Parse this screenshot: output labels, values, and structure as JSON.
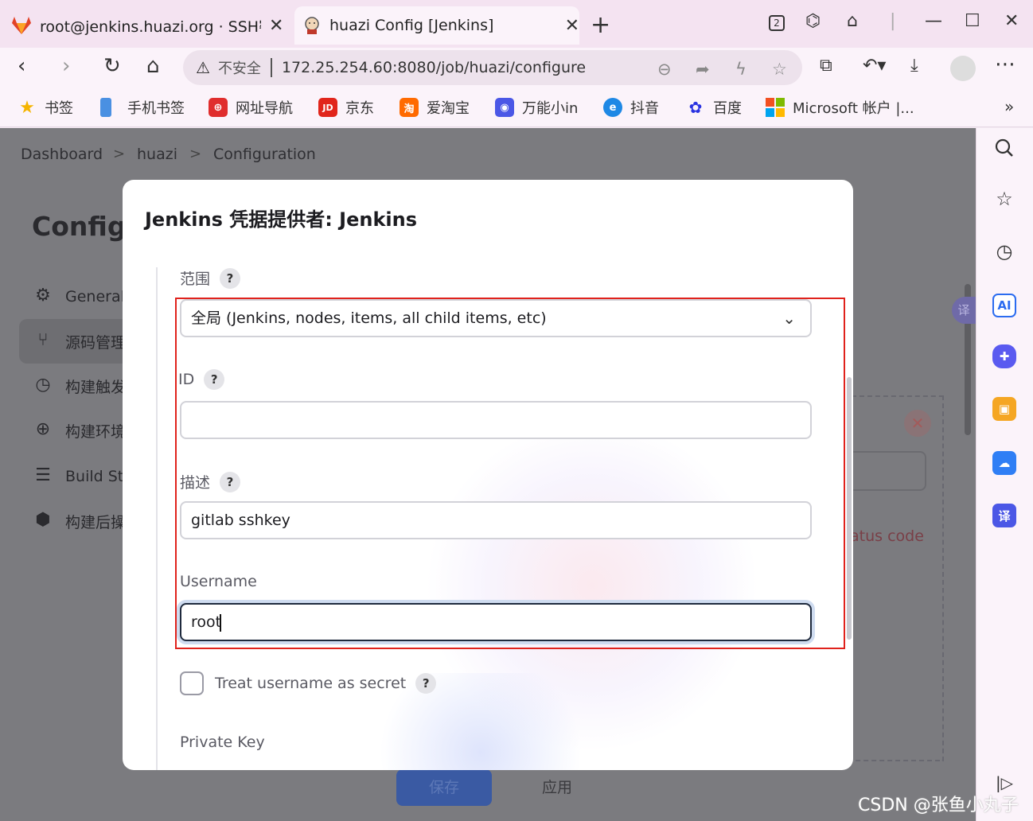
{
  "tabs": [
    {
      "title": "root@jenkins.huazi.org · SSH密钥",
      "icon": "gitlab-icon"
    },
    {
      "title": "huazi Config [Jenkins]",
      "icon": "jenkins-icon"
    }
  ],
  "window": {
    "tab_count_badge": "2"
  },
  "address": {
    "security_label": "不安全",
    "url": "172.25.254.60:8080/job/huazi/configure"
  },
  "bookmarks": [
    {
      "label": "书签",
      "icon": "star-icon",
      "color": "#f5b400",
      "glyph": "★"
    },
    {
      "label": "手机书签",
      "icon": "phone-icon",
      "color": "#4a90e2",
      "glyph": ""
    },
    {
      "label": "网址导航",
      "icon": "nav-icon",
      "color": "#e02d2d",
      "glyph": "⊕"
    },
    {
      "label": "京东",
      "icon": "jd-icon",
      "color": "#e1251b",
      "glyph": "JD"
    },
    {
      "label": "爱淘宝",
      "icon": "taobao-icon",
      "color": "#ff6a00",
      "glyph": "淘"
    },
    {
      "label": "万能小in",
      "icon": "robot-icon",
      "color": "#4b57e6",
      "glyph": "◉"
    },
    {
      "label": "抖音",
      "icon": "edge-icon",
      "color": "#1e88e5",
      "glyph": "e"
    },
    {
      "label": "百度",
      "icon": "baidu-icon",
      "color": "#2932e1",
      "glyph": "✿"
    },
    {
      "label": "Microsoft 帐户 |...",
      "icon": "microsoft-icon",
      "color": "#f25022",
      "glyph": ""
    }
  ],
  "bookmarks_more": "»",
  "breadcrumb": {
    "items": [
      "Dashboard",
      "huazi",
      "Configuration"
    ],
    "sep": ">"
  },
  "page": {
    "title": "Configu",
    "side_items": [
      {
        "label": "General",
        "icon": "gear-icon",
        "glyph": "⚙"
      },
      {
        "label": "源码管理",
        "icon": "branch-icon",
        "glyph": "⑂"
      },
      {
        "label": "构建触发",
        "icon": "clock-icon",
        "glyph": "◷"
      },
      {
        "label": "构建环境",
        "icon": "globe-icon",
        "glyph": "⊕"
      },
      {
        "label": "Build St",
        "icon": "list-icon",
        "glyph": "☰"
      },
      {
        "label": "构建后操",
        "icon": "package-icon",
        "glyph": "⬢"
      }
    ],
    "save_label": "保存",
    "apply_label": "应用",
    "bg_status_text": "atus code",
    "translate_float": "译"
  },
  "modal": {
    "title": "Jenkins 凭据提供者: Jenkins",
    "scope_label": "范围",
    "scope_value": "全局 (Jenkins, nodes, items, all child items, etc)",
    "id_label": "ID",
    "id_value": "",
    "desc_label": "描述",
    "desc_value": "gitlab sshkey",
    "username_label": "Username",
    "username_value": "root",
    "treat_secret_label": "Treat username as secret",
    "treat_secret_checked": false,
    "private_key_label": "Private Key",
    "help_glyph": "?"
  },
  "sidepanel": [
    {
      "icon": "search-icon",
      "glyph": "⌕"
    },
    {
      "icon": "star-outline-icon",
      "glyph": "☆"
    },
    {
      "icon": "history-icon",
      "glyph": "◷"
    },
    {
      "icon": "ai-icon",
      "glyph": "AI",
      "color": "#2b6cf0"
    },
    {
      "icon": "gamepad-icon",
      "glyph": "◆",
      "color": "#5a5af0"
    },
    {
      "icon": "toolbox-icon",
      "glyph": "▣",
      "color": "#f5a623"
    },
    {
      "icon": "cloud-icon",
      "glyph": "☁",
      "color": "#2f7ef5"
    },
    {
      "icon": "translate-icon",
      "glyph": "译",
      "color": "#4b57e6"
    }
  ],
  "sidepanel_collapse": "|▷",
  "watermark": "CSDN @张鱼小丸子"
}
